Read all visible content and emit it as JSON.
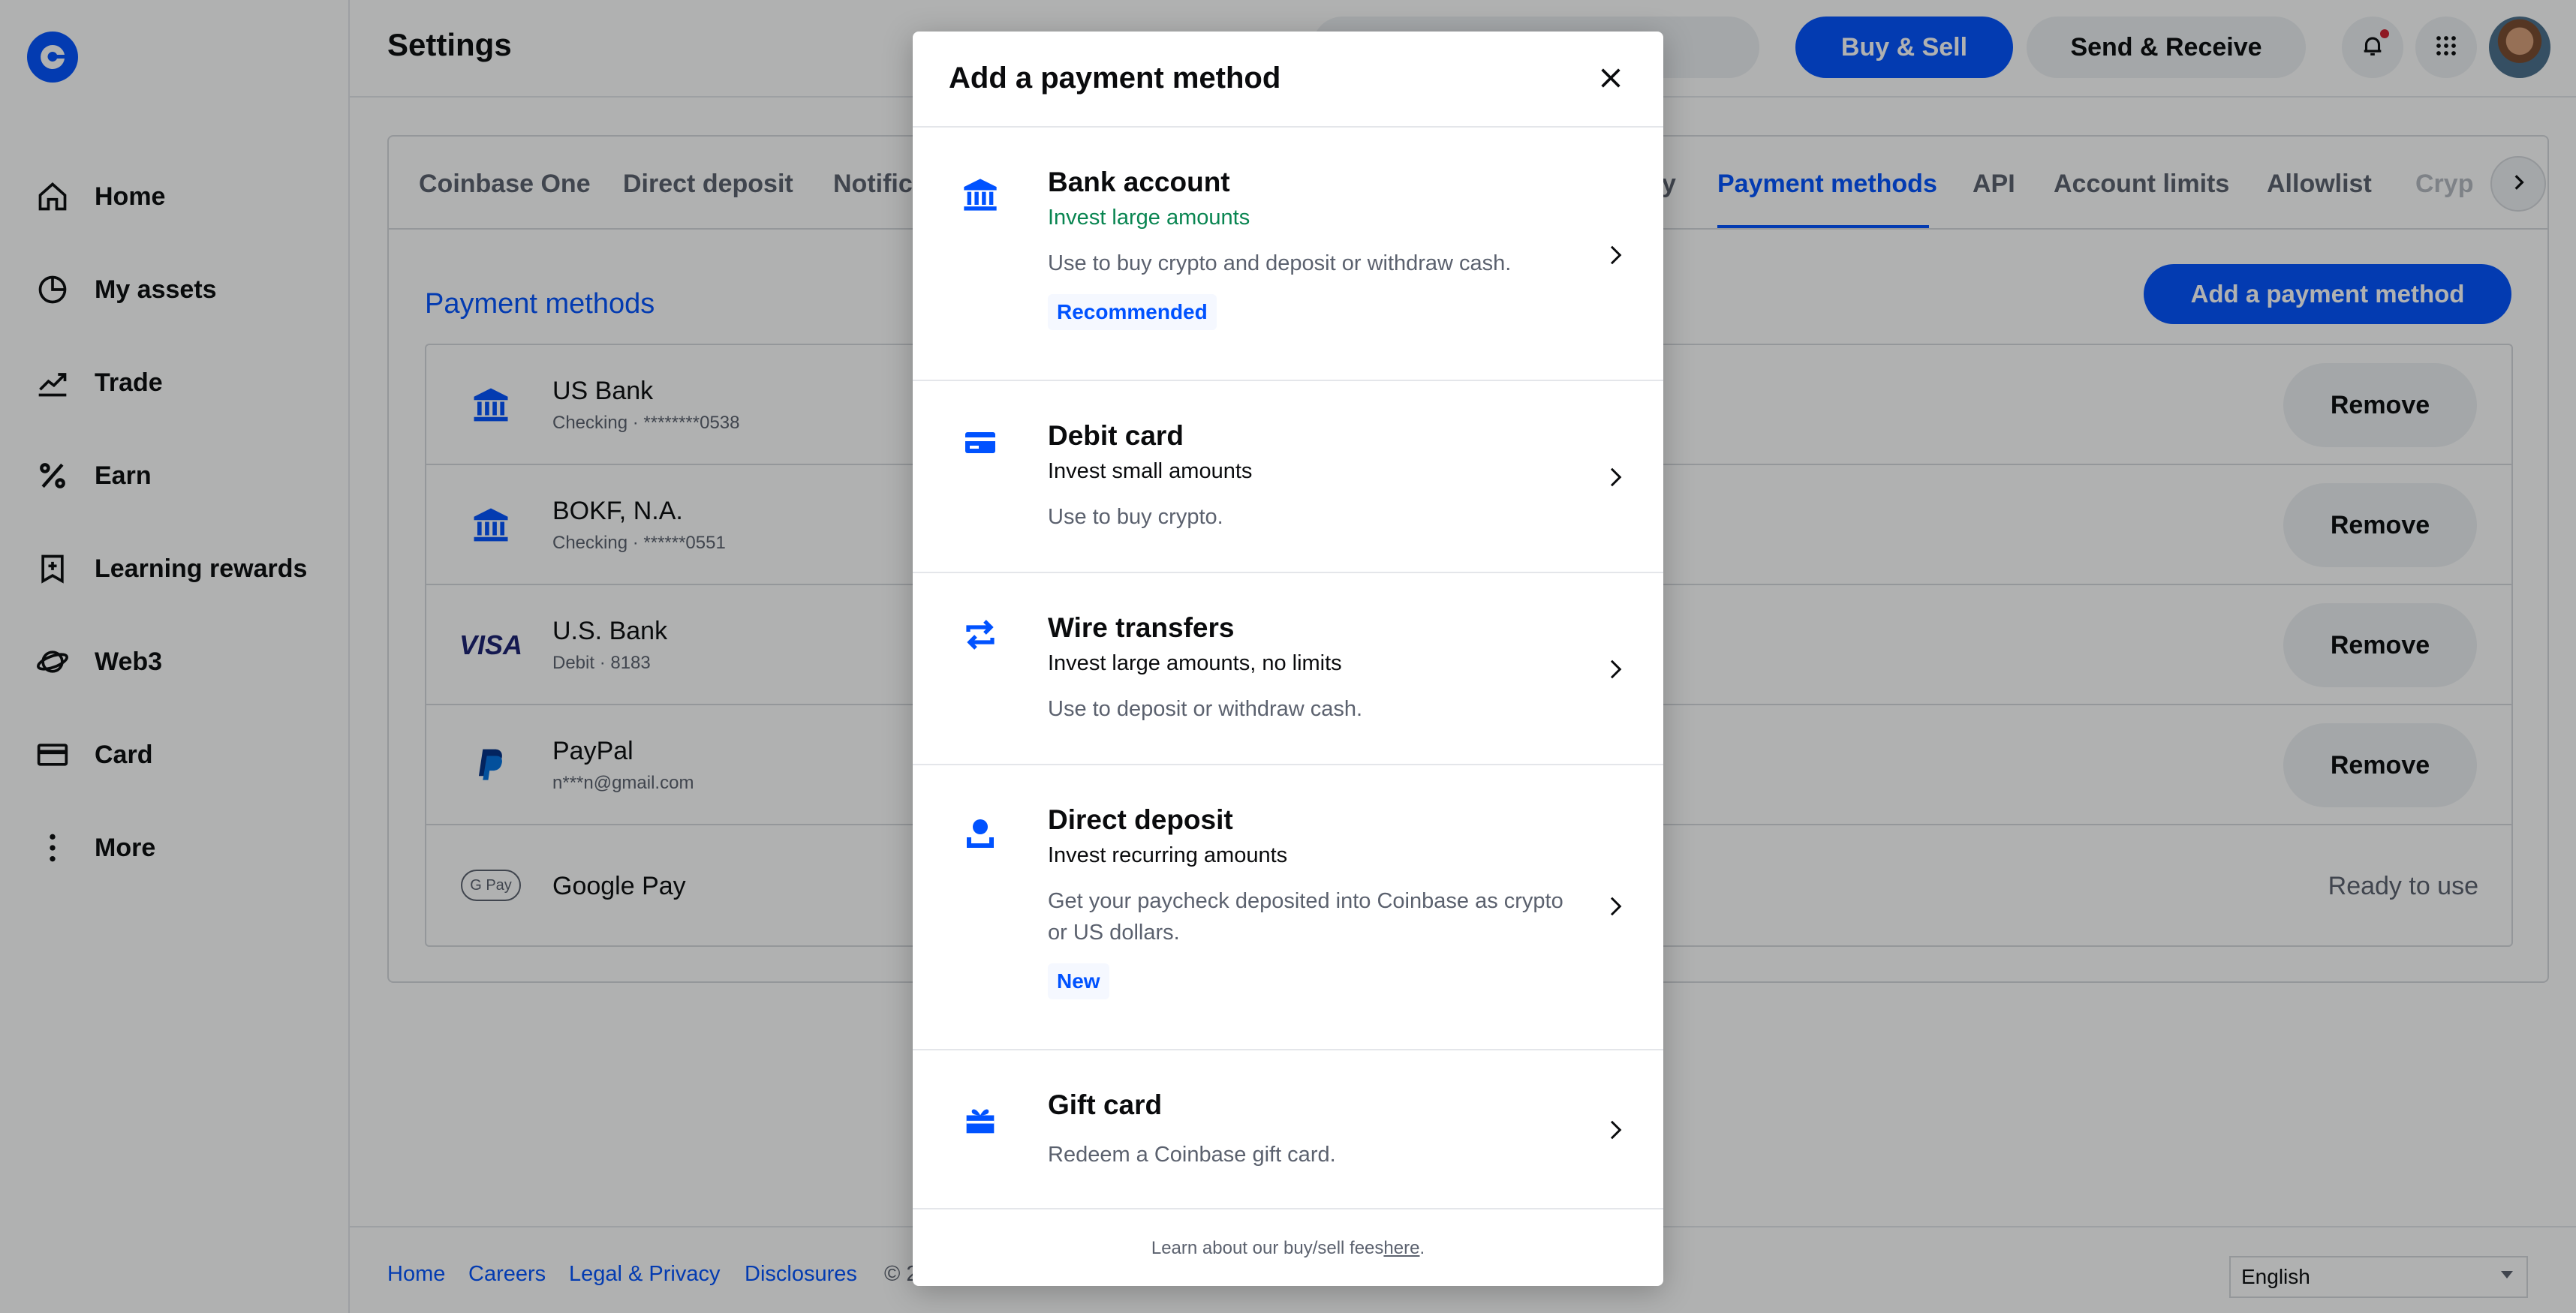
{
  "header": {
    "page_title": "Settings",
    "buy_sell_label": "Buy & Sell",
    "send_receive_label": "Send & Receive"
  },
  "sidebar": {
    "items": [
      {
        "label": "Home",
        "icon": "home-icon"
      },
      {
        "label": "My assets",
        "icon": "pie-chart-icon"
      },
      {
        "label": "Trade",
        "icon": "trend-icon"
      },
      {
        "label": "Earn",
        "icon": "percent-icon"
      },
      {
        "label": "Learning rewards",
        "icon": "learning-rewards-icon"
      },
      {
        "label": "Web3",
        "icon": "web3-icon"
      },
      {
        "label": "Card",
        "icon": "card-icon"
      },
      {
        "label": "More",
        "icon": "more-vertical-icon"
      }
    ]
  },
  "tabs": [
    "Coinbase One",
    "Direct deposit",
    "Notific",
    "y",
    "Payment methods",
    "API",
    "Account limits",
    "Allowlist",
    "Cryp"
  ],
  "active_tab": "Payment methods",
  "payment_methods": {
    "title": "Payment methods",
    "add_button_label": "Add a payment method",
    "remove_label": "Remove",
    "rows": [
      {
        "name": "US Bank",
        "detail": "Checking · ********0538",
        "icon": "bank-icon"
      },
      {
        "name": "BOKF, N.A.",
        "detail": "Checking · ******0551",
        "icon": "bank-icon"
      },
      {
        "name": "U.S. Bank",
        "detail": "Debit · 8183",
        "icon": "visa-icon"
      },
      {
        "name": "PayPal",
        "detail": "n***n@gmail.com",
        "icon": "paypal-icon"
      },
      {
        "name": "Google Pay",
        "detail": "",
        "icon": "google-pay-icon",
        "status": "Ready to use",
        "gpay_text": "G Pay"
      }
    ]
  },
  "modal": {
    "title": "Add a payment method",
    "options": [
      {
        "title": "Bank account",
        "subtitle": "Invest large amounts",
        "description": "Use to buy crypto and deposit or withdraw cash.",
        "badge": "Recommended",
        "icon": "bank-icon"
      },
      {
        "title": "Debit card",
        "subtitle": "Invest small amounts",
        "description": "Use to buy crypto.",
        "badge": "",
        "icon": "debit-card-icon"
      },
      {
        "title": "Wire transfers",
        "subtitle": "Invest large amounts, no limits",
        "description": "Use to deposit or withdraw cash.",
        "badge": "",
        "icon": "transfer-arrows-icon"
      },
      {
        "title": "Direct deposit",
        "subtitle": "Invest recurring amounts",
        "description": "Get your paycheck deposited into Coinbase as crypto or US dollars.",
        "badge": "New",
        "icon": "direct-deposit-icon"
      },
      {
        "title": "Gift card",
        "subtitle": "",
        "description": "Redeem a Coinbase gift card.",
        "badge": "",
        "icon": "gift-icon"
      }
    ],
    "footer_text": "Learn about our buy/sell fees ",
    "footer_link": "here",
    "footer_end": "."
  },
  "footer": {
    "links": [
      "Home",
      "Careers",
      "Legal & Privacy",
      "Disclosures"
    ],
    "copyright": "© 2",
    "language": "English"
  },
  "colors": {
    "accent": "#0052ff",
    "green": "#098551",
    "muted": "#5b616e",
    "notification": "#cf202f"
  }
}
